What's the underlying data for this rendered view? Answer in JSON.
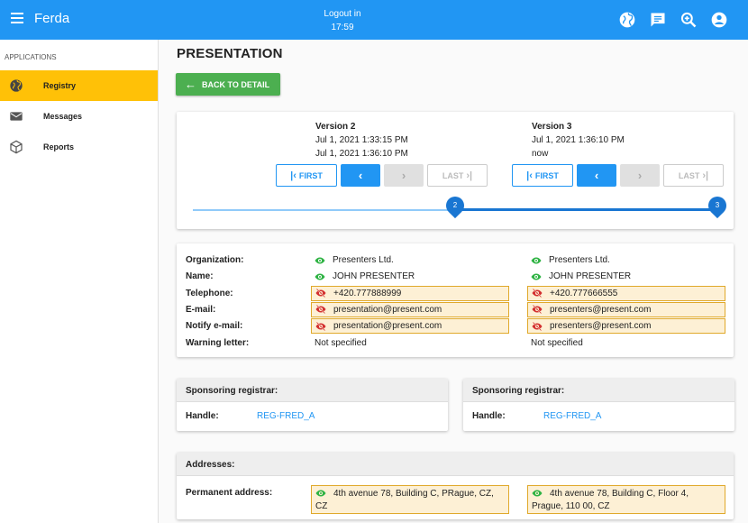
{
  "topbar": {
    "app_title": "Ferda",
    "logout_label": "Logout in",
    "logout_time": "17:59",
    "icons": [
      "globe-icon",
      "feedback-icon",
      "zoom-in-icon",
      "account-icon"
    ]
  },
  "sidebar": {
    "section_label": "APPLICATIONS",
    "items": [
      {
        "label": "Registry",
        "icon": "globe-icon",
        "active": true
      },
      {
        "label": "Messages",
        "icon": "mail-icon",
        "active": false
      },
      {
        "label": "Reports",
        "icon": "cube-icon",
        "active": false
      }
    ]
  },
  "page": {
    "title": "PRESENTATION",
    "back_label": "BACK TO DETAIL"
  },
  "versions": [
    {
      "title": "Version 2",
      "from": "Jul 1, 2021 1:33:15 PM",
      "to": "Jul 1, 2021 1:36:10 PM",
      "first_label": "FIRST",
      "last_label": "LAST"
    },
    {
      "title": "Version 3",
      "from": "Jul 1, 2021 1:36:10 PM",
      "to": "now",
      "first_label": "FIRST",
      "last_label": "LAST"
    }
  ],
  "slider": {
    "marks": [
      "2",
      "3"
    ],
    "positions_fraction": [
      0.5,
      1.0
    ]
  },
  "fields": [
    {
      "label": "Organization:",
      "left": "Presenters Ltd.",
      "right": "Presenters Ltd.",
      "visible": true,
      "diff": false
    },
    {
      "label": "Name:",
      "left": "JOHN PRESENTER",
      "right": "JOHN PRESENTER",
      "visible": true,
      "diff": false
    },
    {
      "label": "Telephone:",
      "left": "+420.777888999",
      "right": "+420.777666555",
      "visible": false,
      "diff": true
    },
    {
      "label": "E-mail:",
      "left": "presentation@present.com",
      "right": "presenters@present.com",
      "visible": false,
      "diff": true
    },
    {
      "label": "Notify e-mail:",
      "left": "presentation@present.com",
      "right": "presenters@present.com",
      "visible": false,
      "diff": true
    },
    {
      "label": "Warning letter:",
      "left": "Not specified",
      "right": "Not specified",
      "visible": null,
      "diff": false
    }
  ],
  "sponsoring": [
    {
      "title": "Sponsoring registrar:",
      "handle_label": "Handle:",
      "handle": "REG-FRED_A"
    },
    {
      "title": "Sponsoring registrar:",
      "handle_label": "Handle:",
      "handle": "REG-FRED_A"
    }
  ],
  "addresses": {
    "title": "Addresses:",
    "permanent_label": "Permanent address:",
    "left_line1": "4th avenue 78, Building C, PRague, CZ,",
    "left_line2": "CZ",
    "right_line1": "4th avenue 78, Building C, Floor 4,",
    "right_line2": "Prague, 110 00, CZ"
  },
  "colors": {
    "primary": "#2196f3",
    "accent": "#ffc107",
    "success": "#4caf50",
    "diff_bg": "#fdf0d5",
    "diff_border": "#e0a92b",
    "eye_on": "#2fb344",
    "eye_off": "#d32f2f"
  }
}
